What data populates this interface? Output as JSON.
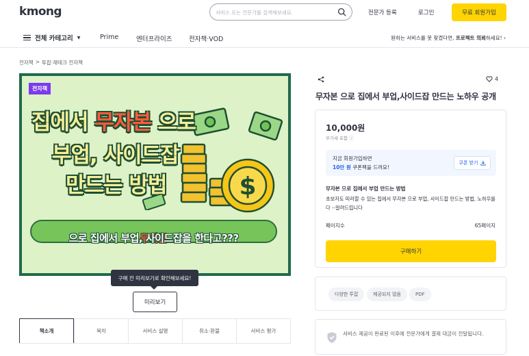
{
  "header": {
    "logo": "kmong",
    "search_placeholder": "서비스 또는 전문가를 검색해보세요.",
    "expert_register": "전문가 등록",
    "login": "로그인",
    "signup": "무료 회원가입"
  },
  "subnav": {
    "all_categories": "전체 카테고리",
    "items": [
      "Prime",
      "엔터프라이즈",
      "전자책·VOD"
    ],
    "request_text": "원하는 서비스를 못 찾겠다면,",
    "request_link": "프로젝트 의뢰",
    "request_suffix": "하세요!"
  },
  "breadcrumb": [
    "전자책",
    ">",
    "투잡·재테크 전자책"
  ],
  "hero": {
    "tag": "전자책",
    "line1_pre": "집에서 ",
    "line1_red": "무자본",
    "line1_post": " 으로",
    "line2": "부업, 사이드잡",
    "line3": "만드는 방법",
    "banner_red": "무자본",
    "banner_rest": " 으로 집에서 부업, 사이드잡을 한다고???"
  },
  "preview": {
    "tooltip": "구매 전 미리보기로 확인해보세요!",
    "button": "미리보기"
  },
  "tabs": [
    "책소개",
    "목차",
    "서비스 설명",
    "취소·환불",
    "서비스 평가"
  ],
  "product": {
    "likes": "4",
    "title": "무자본 으로 집에서 부업,사이드잡 만드는 노하우 공개",
    "price": "10,000원",
    "vat": "부가세 포함 ⓘ",
    "coupon_line1": "지금 회원가입하면",
    "coupon_amount": "10만 원",
    "coupon_line2": " 쿠폰팩을 드려요!",
    "coupon_button": "쿠폰 받기",
    "desc_title": "무자본 으로 집에서 부업 만드는 방법",
    "desc": "초보자도 따라할 수 있는 집에서 무자본 으로 부업, 사이드잡 만드는 방법, 노하우를 다 --알려드립니다",
    "pages_label": "페이지수",
    "pages_value": "65페이지",
    "buy": "구매하기"
  },
  "tags": [
    "다양한 투잡",
    "제공되지 않음",
    "PDF"
  ],
  "notice": "서비스 제공이 완료된 이후에 전문가에게 결제 대금이 전달됩니다.",
  "colors": {
    "accent": "#ffd400",
    "link": "#2563eb",
    "ebook_tag": "#7c3aed"
  }
}
